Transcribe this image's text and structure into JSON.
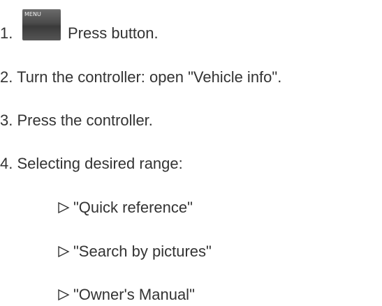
{
  "steps": [
    {
      "number": "1.",
      "text": "Press button.",
      "icon": "menu-button-icon",
      "icon_label": "MENU"
    },
    {
      "number": "2.",
      "text": "Turn the controller: open \"Vehicle info\"."
    },
    {
      "number": "3.",
      "text": "Press the controller."
    },
    {
      "number": "4.",
      "text": "Selecting desired range:"
    }
  ],
  "options": [
    {
      "marker": "triangle-right-icon",
      "text": "\"Quick reference\""
    },
    {
      "marker": "triangle-right-icon",
      "text": "\"Search by pictures\""
    },
    {
      "marker": "triangle-right-icon",
      "text": "\"Owner's Manual\""
    }
  ],
  "colors": {
    "text": "#333333",
    "background": "#ffffff",
    "menu_button": "#4a4a4a"
  }
}
